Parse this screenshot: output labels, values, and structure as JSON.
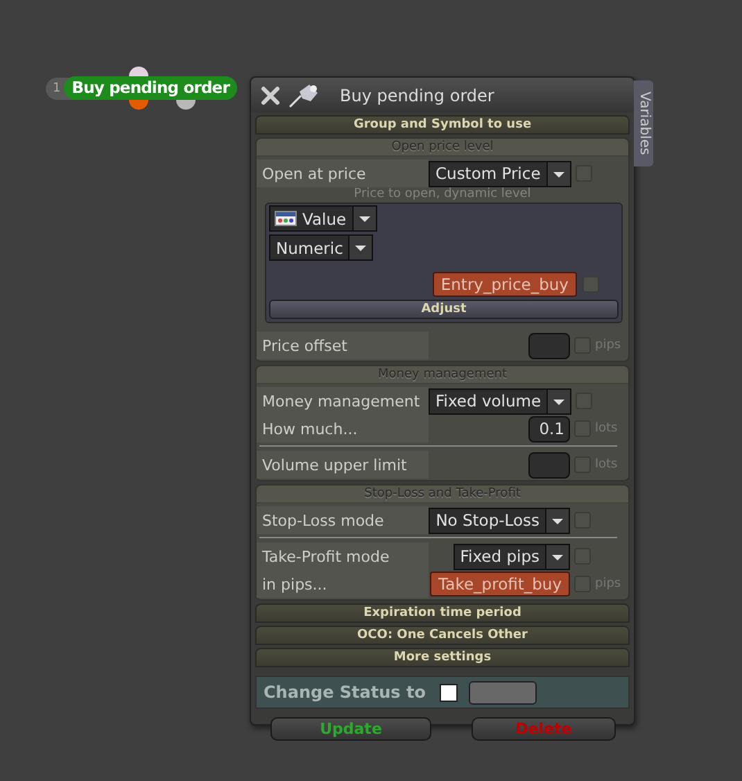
{
  "node": {
    "number": "1",
    "label": "Buy pending order"
  },
  "window": {
    "title": "Buy pending order"
  },
  "side_tab": "Variables",
  "sections": [
    {
      "title": "Group and Symbol to use",
      "expanded": false
    },
    {
      "title": "Open price level",
      "expanded": true,
      "groups": [
        [
          {
            "kind": "select",
            "label": "Open at price",
            "value": "Custom Price",
            "checked": false
          },
          {
            "kind": "subpanel",
            "caption": "Price to open, dynamic level",
            "selects": [
              "Value",
              "Numeric"
            ],
            "variable": "Entry_price_buy",
            "checked": false,
            "button": "Adjust"
          },
          {
            "kind": "number",
            "label": "Price offset",
            "unit": "pips",
            "checked": false
          }
        ]
      ]
    },
    {
      "title": "Money management",
      "expanded": true,
      "groups": [
        [
          {
            "kind": "select",
            "label": "Money management",
            "value": "Fixed volume",
            "checked": false
          },
          {
            "kind": "number",
            "label": "How much...",
            "value": "0.1",
            "unit": "lots",
            "checked": false
          }
        ],
        [
          {
            "kind": "number",
            "label": "Volume upper limit",
            "unit": "lots",
            "checked": false
          }
        ]
      ]
    },
    {
      "title": "Stop-Loss and Take-Profit",
      "expanded": true,
      "groups": [
        [
          {
            "kind": "select",
            "label": "Stop-Loss mode",
            "value": "No Stop-Loss",
            "checked": false
          }
        ],
        [
          {
            "kind": "select",
            "label": "Take-Profit mode",
            "value": "Fixed pips",
            "checked": false
          },
          {
            "kind": "variable",
            "label": "in pips...",
            "value": "Take_profit_buy",
            "unit": "pips",
            "checked": false
          }
        ]
      ]
    },
    {
      "title": "Expiration time period",
      "expanded": false
    },
    {
      "title": "OCO: One Cancels Other",
      "expanded": false
    },
    {
      "title": "More settings",
      "expanded": false
    }
  ],
  "status": {
    "label": "Change Status to",
    "checked": false
  },
  "buttons": [
    {
      "label": "Update",
      "kind": "update"
    },
    {
      "label": "Delete",
      "kind": "delete"
    }
  ]
}
